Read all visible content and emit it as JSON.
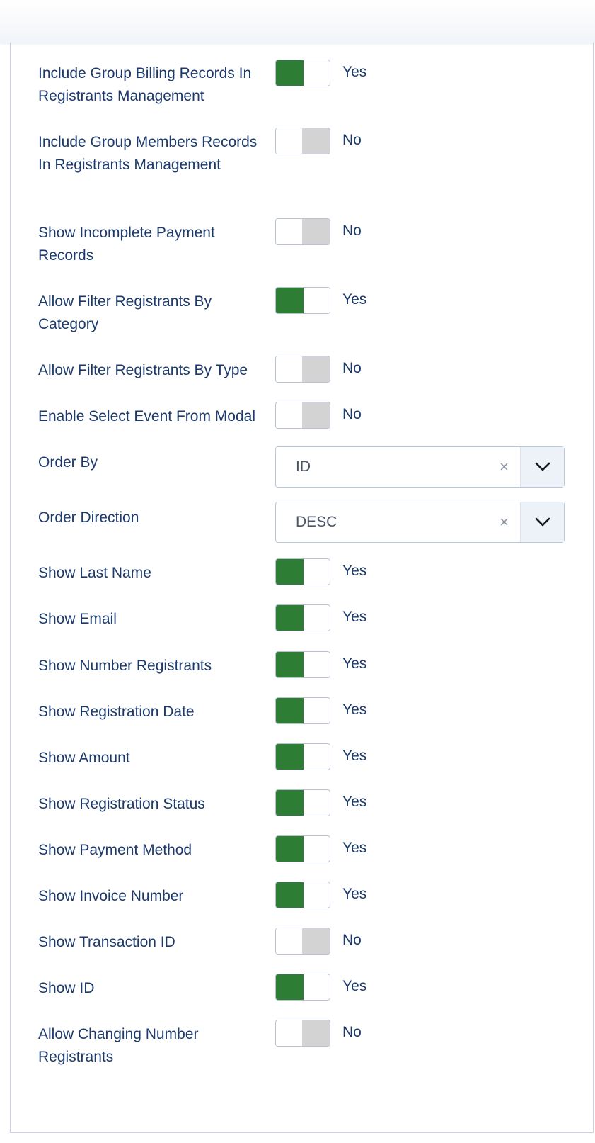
{
  "settings": [
    {
      "label": "Include Group Billing Records In Registrants Management",
      "type": "toggle",
      "on": true,
      "state": "Yes"
    },
    {
      "label": "Include Group Members Records In Registrants Management",
      "type": "toggle",
      "on": false,
      "state": "No"
    },
    {
      "label": "Show Incomplete Payment Records",
      "type": "toggle",
      "on": false,
      "state": "No"
    },
    {
      "label": "Allow Filter Registrants By Category",
      "type": "toggle",
      "on": true,
      "state": "Yes"
    },
    {
      "label": "Allow Filter Registrants By Type",
      "type": "toggle",
      "on": false,
      "state": "No"
    },
    {
      "label": "Enable Select Event From Modal",
      "type": "toggle",
      "on": false,
      "state": "No"
    },
    {
      "label": "Order By",
      "type": "select",
      "value": "ID",
      "clear_glyph": "×"
    },
    {
      "label": "Order Direction",
      "type": "select",
      "value": "DESC",
      "clear_glyph": "×"
    },
    {
      "label": "Show Last Name",
      "type": "toggle",
      "on": true,
      "state": "Yes"
    },
    {
      "label": "Show Email",
      "type": "toggle",
      "on": true,
      "state": "Yes"
    },
    {
      "label": "Show Number Registrants",
      "type": "toggle",
      "on": true,
      "state": "Yes"
    },
    {
      "label": "Show Registration Date",
      "type": "toggle",
      "on": true,
      "state": "Yes"
    },
    {
      "label": "Show Amount",
      "type": "toggle",
      "on": true,
      "state": "Yes"
    },
    {
      "label": "Show Registration Status",
      "type": "toggle",
      "on": true,
      "state": "Yes"
    },
    {
      "label": "Show Payment Method",
      "type": "toggle",
      "on": true,
      "state": "Yes"
    },
    {
      "label": "Show Invoice Number",
      "type": "toggle",
      "on": true,
      "state": "Yes"
    },
    {
      "label": "Show Transaction ID",
      "type": "toggle",
      "on": false,
      "state": "No"
    },
    {
      "label": "Show ID",
      "type": "toggle",
      "on": true,
      "state": "Yes"
    },
    {
      "label": "Allow Changing Number Registrants",
      "type": "toggle",
      "on": false,
      "state": "No"
    }
  ],
  "colors": {
    "toggle_on": "#2e7d35",
    "toggle_off": "#d3d3d3",
    "label_text": "#1c3a6b",
    "panel_border": "#c9d2de"
  },
  "icons": {
    "clear": "close-icon",
    "dropdown": "chevron-down-icon"
  }
}
